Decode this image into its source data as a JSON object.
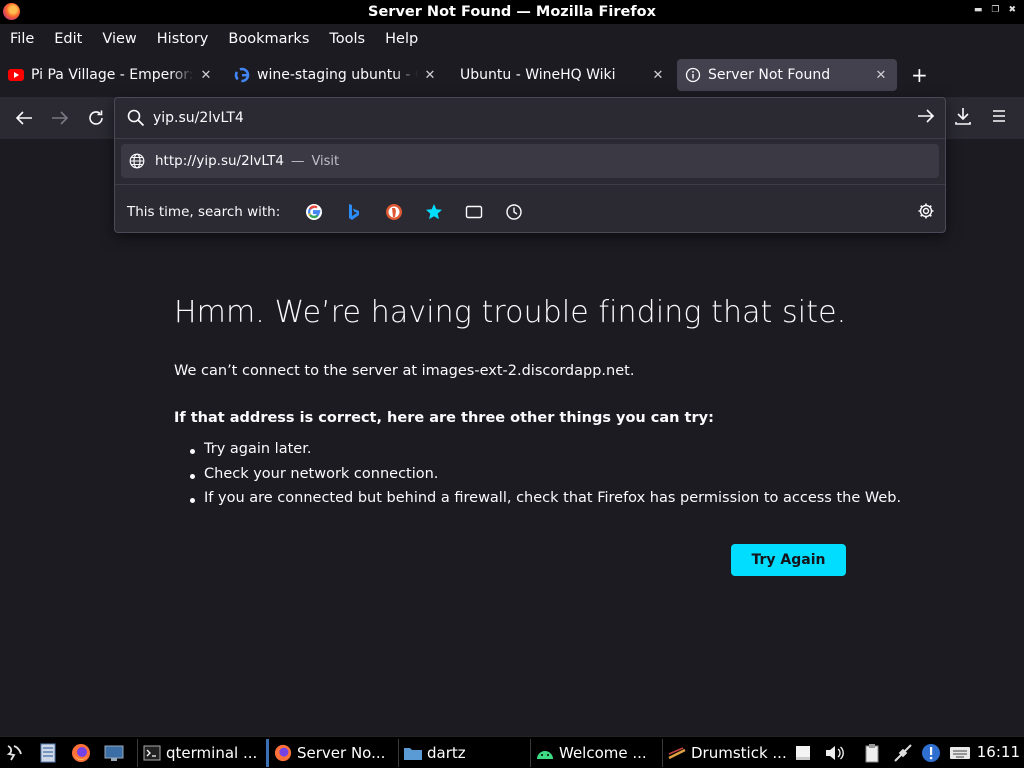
{
  "window": {
    "title": "Server Not Found — Mozilla Firefox"
  },
  "menubar": {
    "items": [
      "File",
      "Edit",
      "View",
      "History",
      "Bookmarks",
      "Tools",
      "Help"
    ]
  },
  "tabs": [
    {
      "label": "Pi Pa Village - Emperor: R",
      "favicon": "youtube-icon",
      "close": "✕"
    },
    {
      "label": "wine-staging ubuntu - Go",
      "favicon": "google-icon",
      "close": "✕"
    },
    {
      "label": "Ubuntu - WineHQ Wiki",
      "favicon": "",
      "close": "✕"
    },
    {
      "label": "Server Not Found",
      "favicon": "info-icon",
      "close": "✕",
      "active": true
    }
  ],
  "urlbar": {
    "value": "yip.su/2lvLT4",
    "suggestion_url": "http://yip.su/2lvLT4",
    "suggestion_dash": "—",
    "suggestion_action": "Visit",
    "search_with_label": "This time, search with:",
    "engines": [
      "google-icon",
      "bing-icon",
      "duckduckgo-icon",
      "bookmarks-star-icon",
      "tabs-icon",
      "history-icon"
    ]
  },
  "error_page": {
    "title": "Hmm. We’re having trouble finding that site.",
    "description": "We can’t connect to the server at images-ext-2.discordapp.net.",
    "heading": "If that address is correct, here are three other things you can try:",
    "suggestions": [
      "Try again later.",
      "Check your network connection.",
      "If you are connected but behind a firewall, check that Firefox has permission to access the Web."
    ],
    "button": "Try Again"
  },
  "taskbar": {
    "tasks": [
      {
        "label": "qterminal ...",
        "icon": "terminal-icon"
      },
      {
        "label": "Server No...",
        "icon": "firefox-icon",
        "active": true
      },
      {
        "label": "dartz",
        "icon": "folder-icon"
      },
      {
        "label": "Welcome ...",
        "icon": "android-icon"
      },
      {
        "label": "Drumstick ...",
        "icon": "drumstick-icon"
      }
    ],
    "clock": "16:11"
  },
  "colors": {
    "accent": "#00ddff",
    "background": "#1c1b22",
    "toolbar": "#2b2a33"
  }
}
